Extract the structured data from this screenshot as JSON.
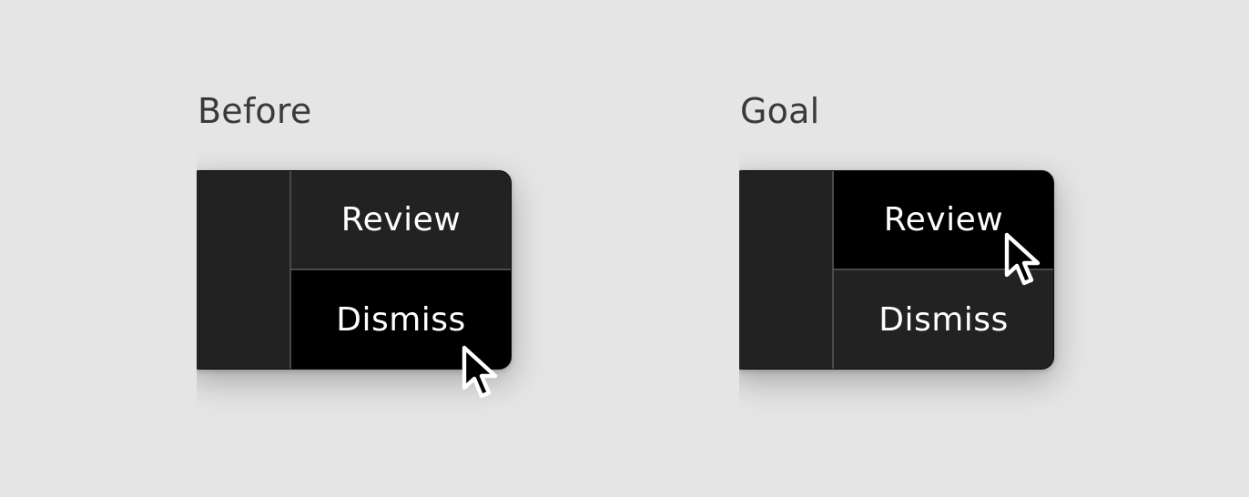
{
  "panels": [
    {
      "title": "Before",
      "actions": {
        "top_label": "Review",
        "bottom_label": "Dismiss",
        "hovered": "bottom"
      },
      "cursor_icon": "arrow-pointer-icon"
    },
    {
      "title": "Goal",
      "actions": {
        "top_label": "Review",
        "bottom_label": "Dismiss",
        "hovered": "top"
      },
      "cursor_icon": "arrow-pointer-icon"
    }
  ],
  "colors": {
    "background": "#e5e5e5",
    "notification_bg": "#222222",
    "hover_bg": "#000000",
    "divider": "#4a4a4a",
    "text": "#ffffff",
    "title_text": "#3a3a3a"
  }
}
